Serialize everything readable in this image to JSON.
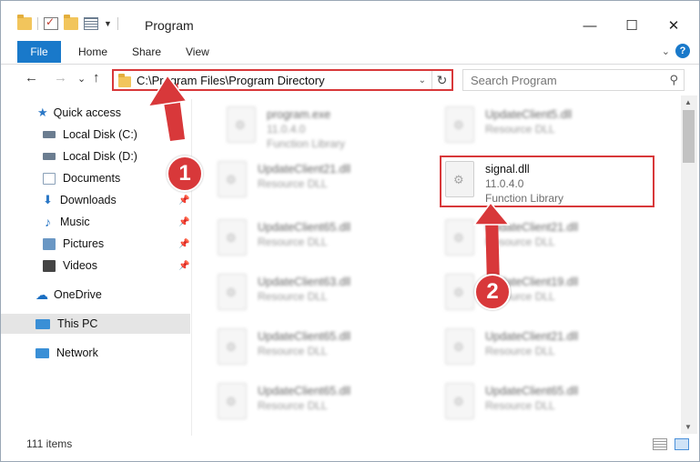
{
  "window": {
    "title": "Program",
    "minimize": "—",
    "maximize": "☐",
    "close": "✕"
  },
  "ribbon": {
    "tabs": [
      "File",
      "Home",
      "Share",
      "View"
    ],
    "collapse": "⌄",
    "help": "?"
  },
  "nav": {
    "back": "←",
    "forward": "→",
    "recent": "⌄",
    "up": "↑",
    "address": "C:\\Program Files\\Program Directory",
    "address_drop": "⌄",
    "refresh": "↻",
    "search_placeholder": "Search Program",
    "search_icon": "⚲"
  },
  "sidebar": {
    "items": [
      {
        "label": "Quick access",
        "icon": "star-icon",
        "color": "#2b78c6"
      },
      {
        "label": "Local Disk (C:)",
        "icon": "drive-icon",
        "color": "#6b7d90"
      },
      {
        "label": "Local Disk (D:)",
        "icon": "drive-icon",
        "color": "#6b7d90"
      },
      {
        "label": "Documents",
        "icon": "documents-icon",
        "color": "#8aa0b8"
      },
      {
        "label": "Downloads",
        "icon": "download-icon",
        "color": "#2b78c6"
      },
      {
        "label": "Music",
        "icon": "music-icon",
        "color": "#2b78c6"
      },
      {
        "label": "Pictures",
        "icon": "pictures-icon",
        "color": "#6a97c4"
      },
      {
        "label": "Videos",
        "icon": "videos-icon",
        "color": "#444"
      },
      {
        "label": "OneDrive",
        "icon": "cloud-icon",
        "color": "#1b6fc2"
      },
      {
        "label": "This PC",
        "icon": "computer-icon",
        "color": "#3a8fd6"
      },
      {
        "label": "Network",
        "icon": "network-icon",
        "color": "#3a8fd6"
      }
    ],
    "pin": "📌"
  },
  "files": [
    {
      "name": "program.exe",
      "l1": "11.0.4.0",
      "l2": "Function Library"
    },
    {
      "name": "UpdateClient5.dll",
      "l1": "Resource DLL",
      "l2": ""
    },
    {
      "name": "UpdateClient21.dll",
      "l1": "Resource DLL",
      "l2": ""
    },
    {
      "name": "signal.dll",
      "l1": "11.0.4.0",
      "l2": "Function Library"
    },
    {
      "name": "UpdateClient65.dll",
      "l1": "Resource DLL",
      "l2": ""
    },
    {
      "name": "UpdateClient21.dll",
      "l1": "Resource DLL",
      "l2": ""
    },
    {
      "name": "UpdateClient63.dll",
      "l1": "Resource DLL",
      "l2": ""
    },
    {
      "name": "UpdateClient19.dll",
      "l1": "Resource DLL",
      "l2": ""
    },
    {
      "name": "UpdateClient65.dll",
      "l1": "Resource DLL",
      "l2": ""
    },
    {
      "name": "UpdateClient21.dll",
      "l1": "Resource DLL",
      "l2": ""
    },
    {
      "name": "UpdateClient65.dll",
      "l1": "Resource DLL",
      "l2": ""
    },
    {
      "name": "UpdateClient65.dll",
      "l1": "Resource DLL",
      "l2": ""
    }
  ],
  "status": {
    "items": "111 items"
  },
  "annotations": {
    "step1": "1",
    "step2": "2",
    "color": "#d8383a"
  }
}
